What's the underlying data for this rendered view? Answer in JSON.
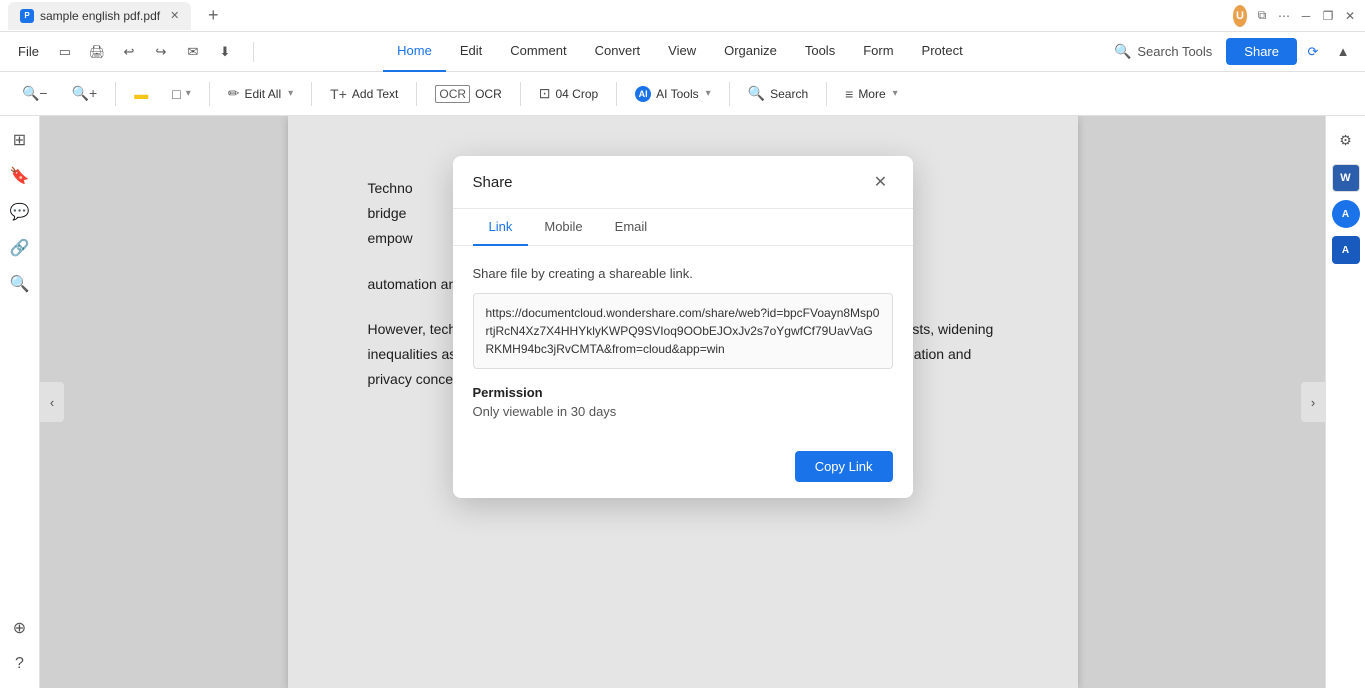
{
  "titleBar": {
    "tab": {
      "label": "sample english pdf.pdf",
      "icon": "W"
    },
    "newTab": "+",
    "windowControls": {
      "minimize": "─",
      "maximize": "□",
      "more": "⋯",
      "close": "✕",
      "restore": "❐"
    }
  },
  "menuBar": {
    "file": "File",
    "navItems": [
      {
        "id": "home",
        "label": "Home",
        "active": true
      },
      {
        "id": "edit",
        "label": "Edit",
        "active": false
      },
      {
        "id": "comment",
        "label": "Comment",
        "active": false
      },
      {
        "id": "convert",
        "label": "Convert",
        "active": false
      },
      {
        "id": "view",
        "label": "View",
        "active": false
      },
      {
        "id": "organize",
        "label": "Organize",
        "active": false
      },
      {
        "id": "tools",
        "label": "Tools",
        "active": false
      },
      {
        "id": "form",
        "label": "Form",
        "active": false
      },
      {
        "id": "protect",
        "label": "Protect",
        "active": false
      }
    ],
    "searchTools": "Search Tools",
    "shareButton": "Share"
  },
  "toolbar": {
    "zoomOut": "zoom-out",
    "zoomIn": "zoom-in",
    "highlight": "highlight",
    "shapes": "shapes",
    "editAll": "Edit All",
    "addText": "Add Text",
    "ocr": "OCR",
    "crop": "Crop",
    "aiTools": "AI Tools",
    "search": "Search",
    "more": "More"
  },
  "leftSidebar": {
    "icons": [
      "page",
      "bookmark",
      "comment",
      "link",
      "search",
      "layers"
    ]
  },
  "rightSidebar": {
    "icons": [
      "filter",
      "word-w",
      "ai-a",
      "word-a"
    ]
  },
  "pdfContent": {
    "paragraphs": [
      "Techno                                                                              ate, work,                                                                              edia, bridge                                                                              tion has tr                                                                              ion, empow                                                                              ace,",
      "automation and AI streamline tasks, opening new job opportunities.",
      "However, technology's rapid integration has generated concerns. The digital divide persists, widening inequalities as some lack access to resources. Social media raises issues like misinformation and privacy concerns, necessitating"
    ]
  },
  "modal": {
    "title": "Share",
    "tabs": [
      {
        "id": "link",
        "label": "Link",
        "active": true
      },
      {
        "id": "mobile",
        "label": "Mobile",
        "active": false
      },
      {
        "id": "email",
        "label": "Email",
        "active": false
      }
    ],
    "description": "Share file by creating a shareable link.",
    "shareUrl": "https://documentcloud.wondershare.com/share/web?id=bpcFVoayn8Msp0rtjRcN4Xz7X4HHYklyKWPQ9SVIoq9OObEJOxJv2s7oYgwfCf79UavVaGRKMH94bc3jRvCMTA&from=cloud&app=win",
    "permissionLabel": "Permission",
    "permissionValue": "Only viewable in 30 days",
    "copyLinkButton": "Copy Link"
  }
}
